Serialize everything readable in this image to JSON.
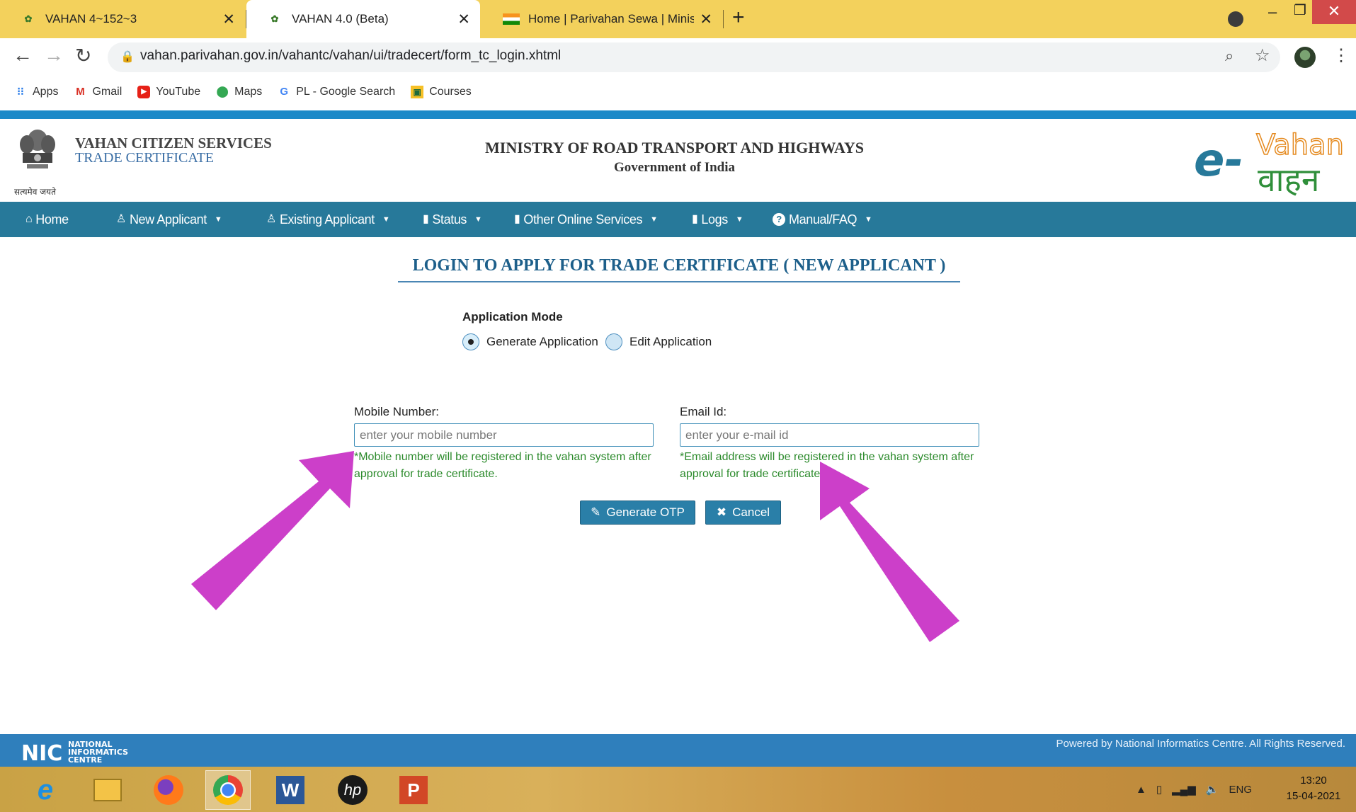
{
  "browser": {
    "tabs": [
      {
        "title": "VAHAN 4~152~3"
      },
      {
        "title": "VAHAN 4.0 (Beta)"
      },
      {
        "title": "Home | Parivahan Sewa | Ministry"
      }
    ],
    "url": "vahan.parivahan.gov.in/vahantc/vahan/ui/tradecert/form_tc_login.xhtml",
    "bookmarks": [
      "Apps",
      "Gmail",
      "YouTube",
      "Maps",
      "PL - Google Search",
      "Courses"
    ]
  },
  "header": {
    "emblem_text": "सत्यमेव जयते",
    "site_title": "VAHAN CITIZEN SERVICES",
    "site_subtitle": "TRADE CERTIFICATE",
    "ministry": "MINISTRY OF ROAD TRANSPORT AND HIGHWAYS",
    "government": "Government of India",
    "logo_text": "e-Vahan"
  },
  "menu": {
    "items": [
      {
        "label": "Home",
        "icon": "home-icon"
      },
      {
        "label": "New Applicant",
        "icon": "user-icon"
      },
      {
        "label": "Existing Applicant",
        "icon": "user-icon"
      },
      {
        "label": "Status",
        "icon": "book-icon"
      },
      {
        "label": "Other Online Services",
        "icon": "book-icon"
      },
      {
        "label": "Logs",
        "icon": "book-icon"
      },
      {
        "label": "Manual/FAQ",
        "icon": "question-icon"
      }
    ]
  },
  "form": {
    "title": "LOGIN TO APPLY FOR TRADE CERTIFICATE ( NEW APPLICANT )",
    "mode_label": "Application Mode",
    "mode_options": [
      "Generate Application",
      "Edit Application"
    ],
    "mode_selected": "Generate Application",
    "mobile_label": "Mobile Number:",
    "mobile_placeholder": "enter your mobile number",
    "mobile_note": "*Mobile number will be registered in the vahan system after approval for trade certificate.",
    "email_label": "Email Id:",
    "email_placeholder": "enter your e-mail id",
    "email_note": "*Email address will be registered in the vahan system after approval for trade certificate.",
    "generate_button": "Generate OTP",
    "cancel_button": "Cancel"
  },
  "footer": {
    "nic_name": "NATIONAL INFORMATICS CENTRE",
    "powered": "Powered by National Informatics Centre. All Rights Reserved."
  },
  "taskbar": {
    "lang": "ENG",
    "time": "13:20",
    "date": "15-04-2021"
  },
  "colors": {
    "menu": "#27799a",
    "accent_strip": "#1b89c8",
    "note_green": "#2b8a2b",
    "annotation_arrow": "#cc3fc9"
  }
}
